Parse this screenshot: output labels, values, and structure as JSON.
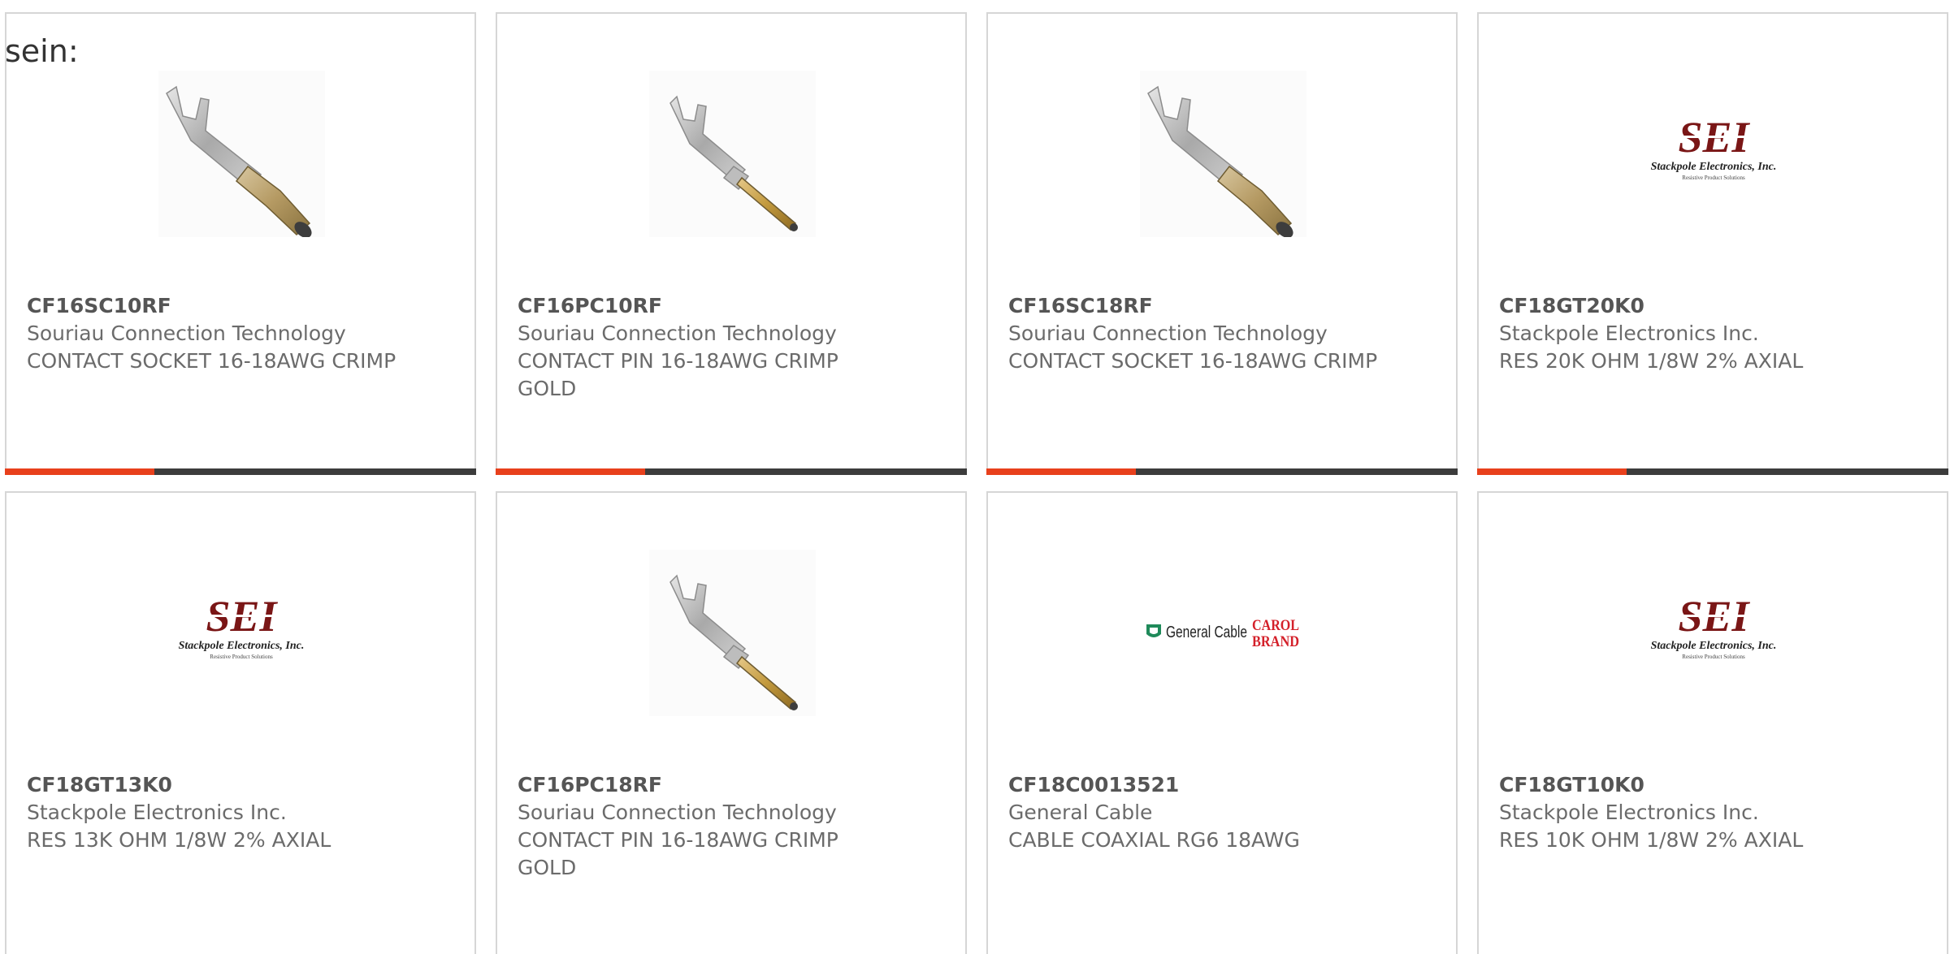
{
  "intro_text": "sein:",
  "colors": {
    "accent": "#e8401c",
    "bar": "#3c3c3c",
    "border": "#d6d6d6",
    "text": "#6b6b6b",
    "sei_red": "#7a1616",
    "carol_red": "#d4202a",
    "general_green": "#1f8a5a"
  },
  "products": [
    {
      "part_number": "CF16SC10RF",
      "manufacturer": "Souriau Connection Technology",
      "description": "CONTACT SOCKET 16-18AWG CRIMP",
      "image": "contact-socket-icon"
    },
    {
      "part_number": "CF16PC10RF",
      "manufacturer": "Souriau Connection Technology",
      "description": "CONTACT PIN 16-18AWG CRIMP GOLD",
      "image": "contact-pin-icon"
    },
    {
      "part_number": "CF16SC18RF",
      "manufacturer": "Souriau Connection Technology",
      "description": "CONTACT SOCKET 16-18AWG CRIMP",
      "image": "contact-socket-icon"
    },
    {
      "part_number": "CF18GT20K0",
      "manufacturer": "Stackpole Electronics Inc.",
      "description": "RES 20K OHM 1/8W 2% AXIAL",
      "image": "sei-logo"
    },
    {
      "part_number": "CF18GT13K0",
      "manufacturer": "Stackpole Electronics Inc.",
      "description": "RES 13K OHM 1/8W 2% AXIAL",
      "image": "sei-logo"
    },
    {
      "part_number": "CF16PC18RF",
      "manufacturer": "Souriau Connection Technology",
      "description": "CONTACT PIN 16-18AWG CRIMP GOLD",
      "image": "contact-pin-icon"
    },
    {
      "part_number": "CF18C0013521",
      "manufacturer": "General Cable",
      "description": "CABLE COAXIAL RG6 18AWG",
      "image": "general-cable-logo"
    },
    {
      "part_number": "CF18GT10K0",
      "manufacturer": "Stackpole Electronics Inc.",
      "description": "RES 10K OHM 1/8W 2% AXIAL",
      "image": "sei-logo"
    }
  ],
  "logos": {
    "sei_mark": "SEI",
    "sei_name": "Stackpole Electronics, Inc.",
    "sei_tagline": "Resistive Product Solutions",
    "general_cable": "General Cable",
    "carol_line1": "CAROL",
    "carol_line2": "BRAND"
  }
}
